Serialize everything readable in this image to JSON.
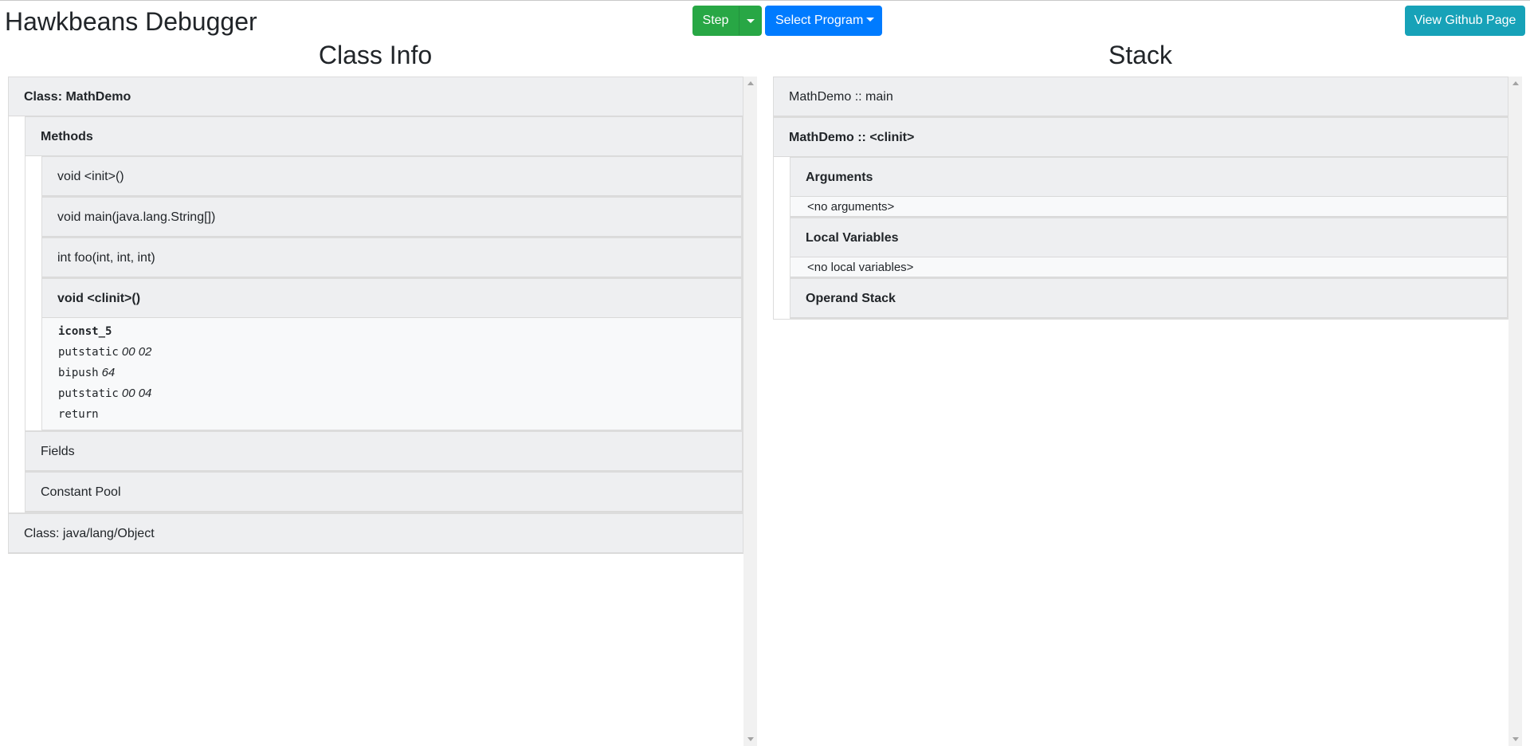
{
  "app": {
    "title": "Hawkbeans Debugger"
  },
  "toolbar": {
    "step_label": "Step",
    "select_program_label": "Select Program",
    "github_label": "View Github Page"
  },
  "class_info": {
    "heading": "Class Info",
    "classes": [
      {
        "header": "Class: MathDemo",
        "methods_header": "Methods",
        "methods": [
          "void <init>()",
          "void main(java.lang.String[])",
          "int foo(int, int, int)",
          "void <clinit>()"
        ],
        "bytecode": [
          {
            "op": "iconst_5",
            "arg": ""
          },
          {
            "op": "putstatic",
            "arg": "00 02"
          },
          {
            "op": "bipush",
            "arg": "64"
          },
          {
            "op": "putstatic",
            "arg": "00 04"
          },
          {
            "op": "return",
            "arg": ""
          }
        ],
        "fields_header": "Fields",
        "constant_pool_header": "Constant Pool"
      },
      {
        "header": "Class: java/lang/Object"
      }
    ]
  },
  "stack": {
    "heading": "Stack",
    "frames": [
      {
        "header": "MathDemo :: main"
      },
      {
        "header": "MathDemo :: <clinit>",
        "arguments_header": "Arguments",
        "arguments_empty": "<no arguments>",
        "locals_header": "Local Variables",
        "locals_empty": "<no local variables>",
        "operand_header": "Operand Stack"
      }
    ]
  },
  "colors": {
    "step": "#28a745",
    "select_program": "#007bff",
    "github": "#17a2b8",
    "card_header": "#eeeff1"
  }
}
